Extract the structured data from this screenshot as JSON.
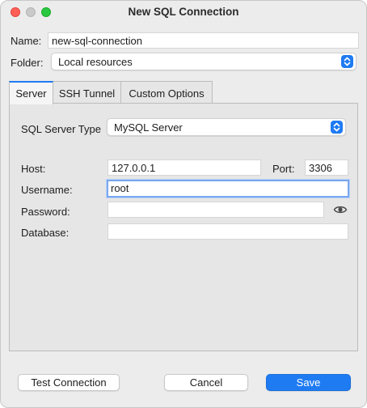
{
  "window": {
    "title": "New SQL Connection"
  },
  "name": {
    "label": "Name:",
    "value": "new-sql-connection"
  },
  "folder": {
    "label": "Folder:",
    "value": "Local resources"
  },
  "tabs": [
    {
      "label": "Server",
      "active": true
    },
    {
      "label": "SSH Tunnel",
      "active": false
    },
    {
      "label": "Custom Options",
      "active": false
    }
  ],
  "server": {
    "type_label": "SQL Server Type",
    "type_value": "MySQL Server",
    "host_label": "Host:",
    "host_value": "127.0.0.1",
    "port_label": "Port:",
    "port_value": "3306",
    "username_label": "Username:",
    "username_value": "root",
    "password_label": "Password:",
    "password_value": "",
    "database_label": "Database:",
    "database_value": ""
  },
  "buttons": {
    "test": "Test Connection",
    "cancel": "Cancel",
    "save": "Save"
  },
  "colors": {
    "accent": "#1f7bf2",
    "close": "#ff5f57",
    "maximize": "#29c840"
  },
  "icons": {
    "password_toggle": "eye-icon",
    "select_stepper": "chevron-updown-icon"
  }
}
